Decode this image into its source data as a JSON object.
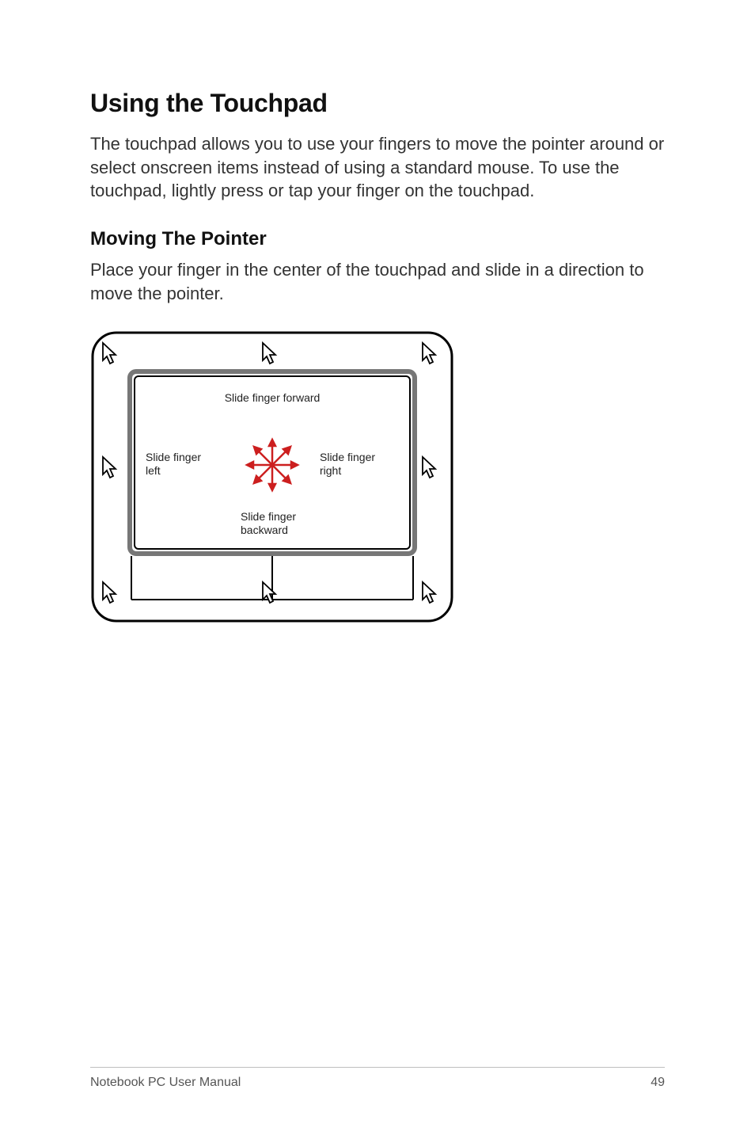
{
  "heading": "Using the Touchpad",
  "intro": "The touchpad allows you to use your fingers to move the pointer around or select onscreen items instead of using a standard mouse. To use the touchpad, lightly press or tap your finger on the touchpad.",
  "subheading": "Moving The Pointer",
  "subtext": "Place your finger in the center of the touchpad and slide in a direction to move the pointer.",
  "diagram": {
    "label_top": "Slide finger forward",
    "label_left_line1": "Slide finger",
    "label_left_line2": "left",
    "label_right_line1": "Slide finger",
    "label_right_line2": "right",
    "label_bottom_line1": "Slide finger",
    "label_bottom_line2": "backward"
  },
  "footer": {
    "left": "Notebook PC User Manual",
    "right": "49"
  }
}
